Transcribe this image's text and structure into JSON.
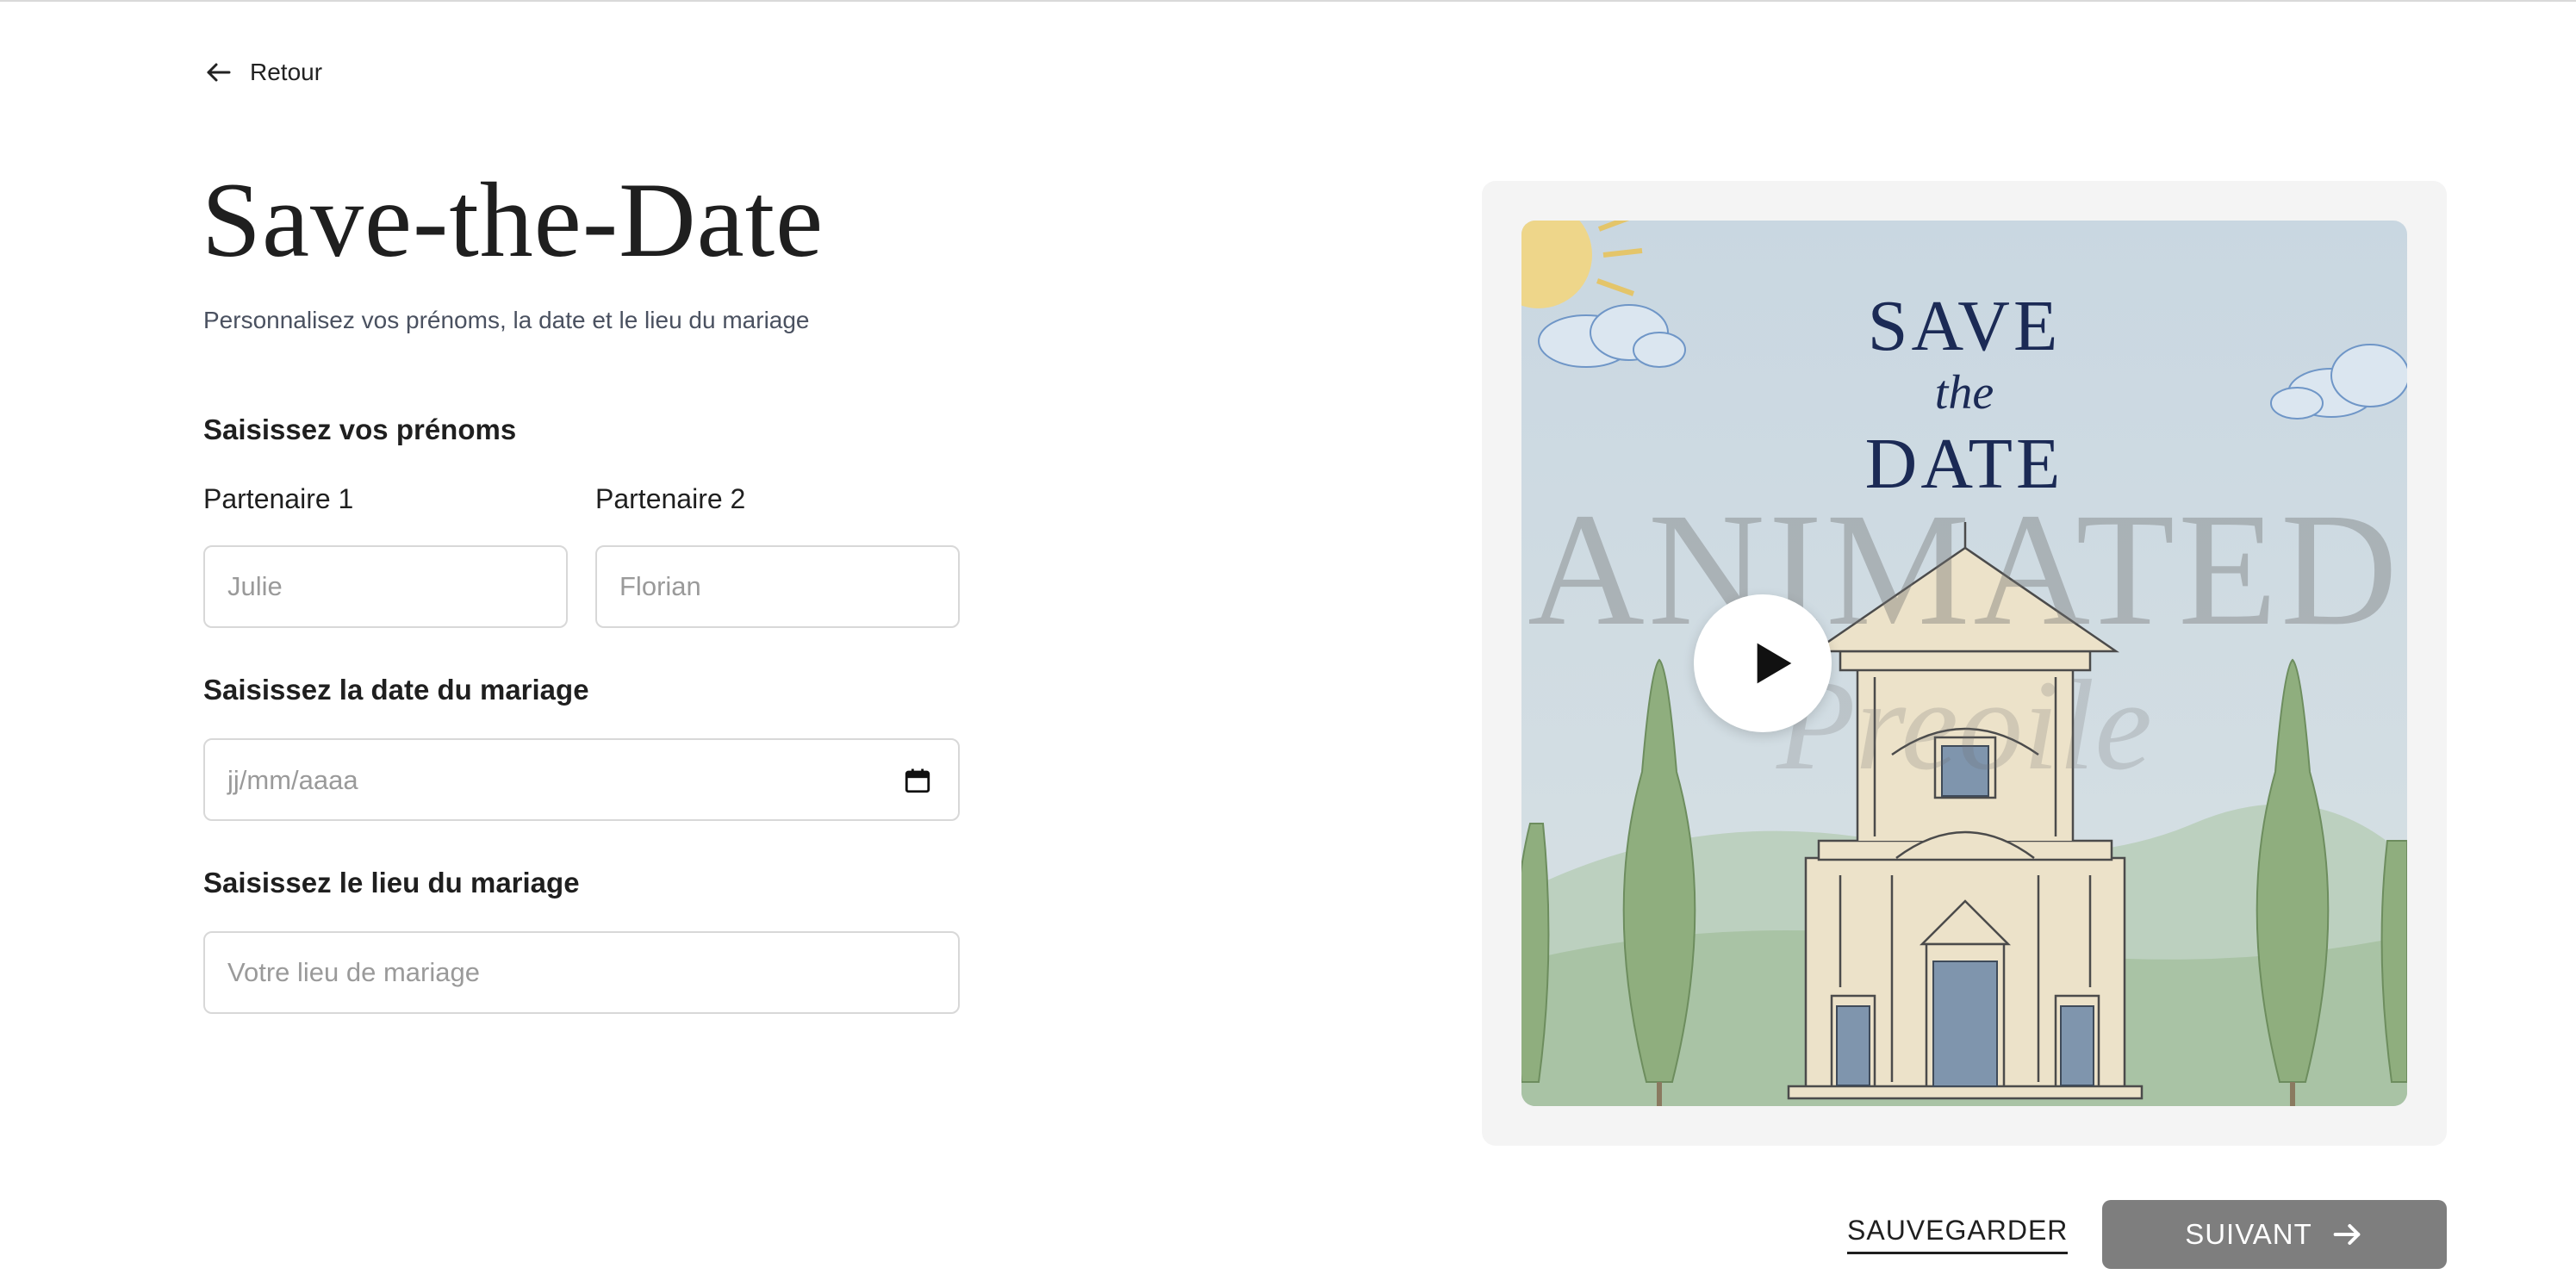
{
  "nav": {
    "back_label": "Retour"
  },
  "header": {
    "title": "Save-the-Date",
    "subtitle": "Personnalisez vos prénoms, la date et le lieu du mariage"
  },
  "form": {
    "names_section": "Saisissez vos prénoms",
    "partner1_label": "Partenaire 1",
    "partner1_placeholder": "Julie",
    "partner2_label": "Partenaire 2",
    "partner2_placeholder": "Florian",
    "date_section": "Saisissez la date du mariage",
    "date_placeholder": "jj/mm/aaaa",
    "place_section": "Saisissez le lieu du mariage",
    "place_placeholder": "Votre lieu de mariage"
  },
  "preview": {
    "line1": "SAVE",
    "line2": "the",
    "line3": "DATE",
    "watermark_main": "ANIMATED",
    "watermark_script": "Preoile"
  },
  "actions": {
    "save_label": "SAUVEGARDER",
    "next_label": "SUIVANT"
  },
  "colors": {
    "next_button_bg": "#7e7e7e",
    "preview_text": "#1b2a55"
  }
}
